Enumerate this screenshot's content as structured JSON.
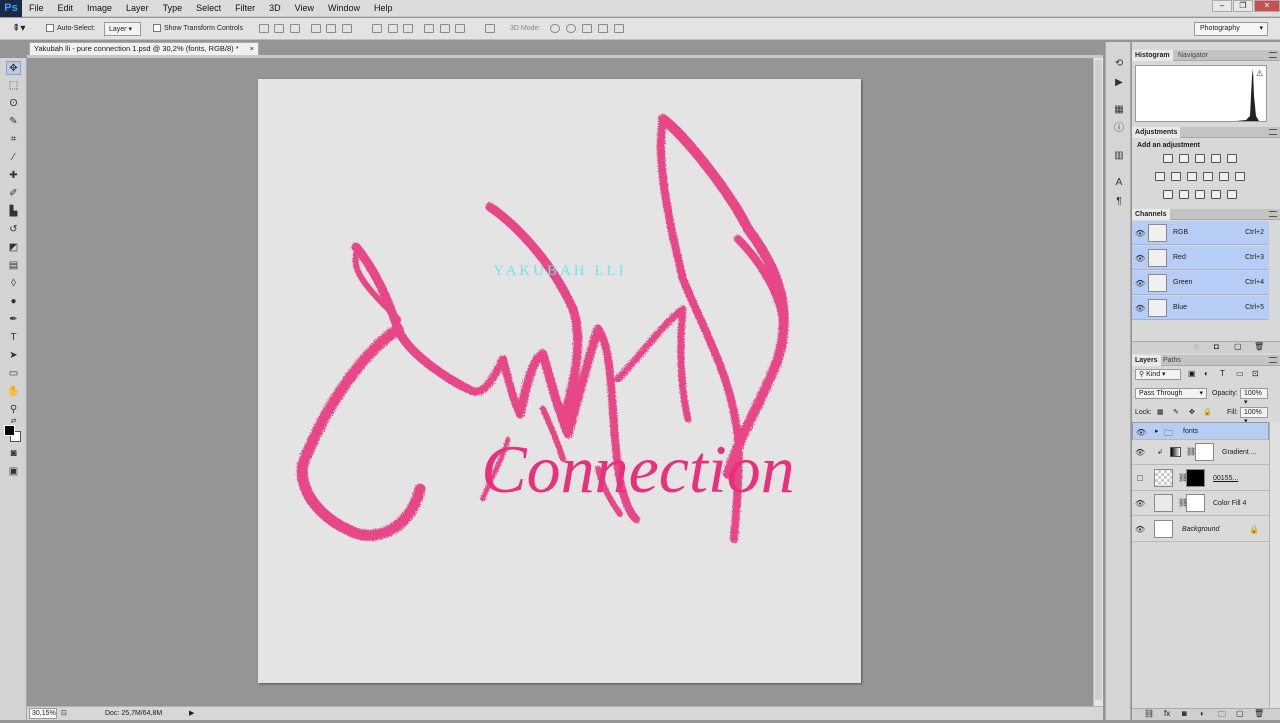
{
  "app": {
    "logo": "Ps"
  },
  "menu": [
    "File",
    "Edit",
    "Image",
    "Layer",
    "Type",
    "Select",
    "Filter",
    "3D",
    "View",
    "Window",
    "Help"
  ],
  "options": {
    "auto_select_label": "Auto-Select:",
    "auto_select_value": "Layer",
    "transform_label": "Show Transform Controls",
    "mode_3d_label": "3D Mode:",
    "workspace": "Photography"
  },
  "document": {
    "tab_title": "Yakubah lli - pure connection 1.psd @ 30,2% (fonts, RGB/8) *",
    "close": "×",
    "artwork": {
      "small_text": "YAKUBAH LLI",
      "script_text": "Connection",
      "accent_color": "#e8317a",
      "small_text_color": "#6ee2ee"
    }
  },
  "status": {
    "zoom": "30,15%",
    "doc_info": "Doc: 25,7M/64,8M"
  },
  "panels": {
    "histogram_tabs": [
      "Histogram",
      "Navigator"
    ],
    "adjustments_tab": "Adjustments",
    "adjustments_title": "Add an adjustment",
    "channels_tab": "Channels",
    "channels": [
      {
        "name": "RGB",
        "shortcut": "Ctrl+2"
      },
      {
        "name": "Red",
        "shortcut": "Ctrl+3"
      },
      {
        "name": "Green",
        "shortcut": "Ctrl+4"
      },
      {
        "name": "Blue",
        "shortcut": "Ctrl+5"
      }
    ],
    "layers_tabs": [
      "Layers",
      "Paths"
    ],
    "kind": "Kind",
    "blend_mode": "Pass Through",
    "opacity_label": "Opacity:",
    "opacity": "100%",
    "lock_label": "Lock:",
    "fill_label": "Fill:",
    "fill": "100%",
    "layers": [
      {
        "name": "fonts"
      },
      {
        "name": "Gradient ..."
      },
      {
        "name": "00155..."
      },
      {
        "name": "Color Fill 4"
      },
      {
        "name": "Background"
      }
    ]
  }
}
